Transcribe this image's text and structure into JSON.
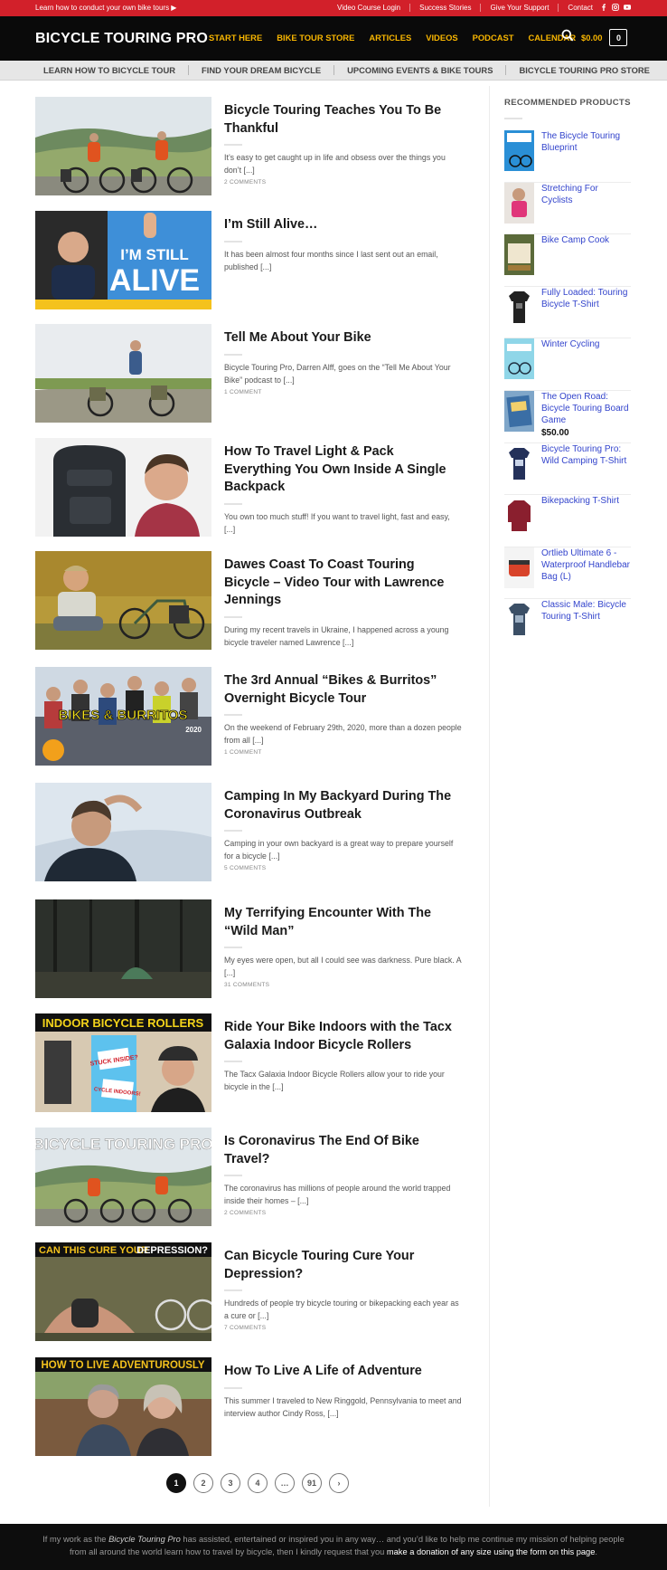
{
  "topbar": {
    "promo": "Learn how to conduct your own bike tours ▶",
    "links": [
      "Video Course Login",
      "Success Stories",
      "Give Your Support",
      "Contact"
    ]
  },
  "header": {
    "logo": "BICYCLE TOURING PRO",
    "nav": [
      "START HERE",
      "BIKE TOUR STORE",
      "ARTICLES",
      "VIDEOS",
      "PODCAST",
      "CALENDAR"
    ],
    "cart_total": "$0.00",
    "cart_count": "0"
  },
  "subnav": [
    "LEARN HOW TO BICYCLE TOUR",
    "FIND YOUR DREAM BICYCLE",
    "UPCOMING EVENTS & BIKE TOURS",
    "BICYCLE TOURING PRO STORE"
  ],
  "posts": [
    {
      "title": "Bicycle Touring Teaches You To Be Thankful",
      "excerpt": "It’s easy to get caught up in life and obsess over the things you don’t [...]",
      "comments": "2 COMMENTS"
    },
    {
      "title": "I’m Still Alive…",
      "excerpt": " It has been almost four months since I last sent out an email, published [...]",
      "comments": ""
    },
    {
      "title": "Tell Me About Your Bike",
      "excerpt": "Bicycle Touring Pro, Darren Alff, goes on the “Tell Me About Your Bike” podcast to [...]",
      "comments": "1 COMMENT"
    },
    {
      "title": "How To Travel Light & Pack Everything You Own Inside A Single Backpack",
      "excerpt": " You own too much stuff! If you want to travel light, fast and easy, [...]",
      "comments": ""
    },
    {
      "title": "Dawes Coast To Coast Touring Bicycle – Video Tour with Lawrence Jennings",
      "excerpt": "During my recent travels in Ukraine, I happened across a young bicycle traveler named Lawrence [...]",
      "comments": ""
    },
    {
      "title": "The 3rd Annual “Bikes & Burritos” Overnight Bicycle Tour",
      "excerpt": " On the weekend of February 29th, 2020, more than a dozen people from all [...]",
      "comments": "1 COMMENT"
    },
    {
      "title": "Camping In My Backyard During The Coronavirus Outbreak",
      "excerpt": "Camping in your own backyard is a great way to prepare yourself for a bicycle [...]",
      "comments": "5 COMMENTS"
    },
    {
      "title": "My Terrifying Encounter With The “Wild Man”",
      "excerpt": " My eyes were open, but all I could see was darkness. Pure black. A [...]",
      "comments": "31 COMMENTS"
    },
    {
      "title": "Ride Your Bike Indoors with the Tacx Galaxia Indoor Bicycle Rollers",
      "excerpt": " The Tacx Galaxia Indoor Bicycle Rollers allow your to ride your bicycle in the [...]",
      "comments": ""
    },
    {
      "title": "Is Coronavirus The End Of Bike Travel?",
      "excerpt": " The coronavirus has millions of people around the world trapped inside their homes – [...]",
      "comments": "2 COMMENTS"
    },
    {
      "title": "Can Bicycle Touring Cure Your Depression?",
      "excerpt": " Hundreds of people try bicycle touring or bikepacking each year as a cure or [...]",
      "comments": "7 COMMENTS"
    },
    {
      "title": "How To Live A Life of Adventure",
      "excerpt": "This summer I traveled to New Ringgold, Pennsylvania to meet and interview author Cindy Ross, [...]",
      "comments": ""
    }
  ],
  "thumb_texts": {
    "still_alive_1": "I’M STILL",
    "still_alive_2": "ALIVE",
    "bikes_burritos": "BIKES & BURRITOS",
    "bikes_burritos_year": "2020",
    "rollers_banner": "INDOOR BICYCLE ROLLERS",
    "rollers_stuck": "STUCK INSIDE?",
    "rollers_cycle": "CYCLE INDOORS!",
    "btp_banner": "BICYCLE TOURING PRO",
    "depression_banner_1": "CAN THIS CURE YOUR",
    "depression_banner_2": "DEPRESSION?",
    "adventure_banner": "HOW TO LIVE ADVENTUROUSLY"
  },
  "sidebar": {
    "title": "RECOMMENDED PRODUCTS",
    "products": [
      {
        "name": "The Bicycle Touring Blueprint",
        "price": ""
      },
      {
        "name": "Stretching For Cyclists",
        "price": ""
      },
      {
        "name": "Bike Camp Cook",
        "price": ""
      },
      {
        "name": "Fully Loaded: Touring Bicycle T-Shirt",
        "price": ""
      },
      {
        "name": "Winter Cycling",
        "price": ""
      },
      {
        "name": "The Open Road: Bicycle Touring Board Game",
        "price": "$50.00"
      },
      {
        "name": "Bicycle Touring Pro: Wild Camping T-Shirt",
        "price": ""
      },
      {
        "name": "Bikepacking T-Shirt",
        "price": ""
      },
      {
        "name": "Ortlieb Ultimate 6 - Waterproof Handlebar Bag (L)",
        "price": ""
      },
      {
        "name": "Classic Male: Bicycle Touring T-Shirt",
        "price": ""
      }
    ]
  },
  "pagination": [
    "1",
    "2",
    "3",
    "4",
    "…",
    "91",
    "›"
  ],
  "footer": {
    "text_1": "If my work as the ",
    "italic": "Bicycle Touring Pro",
    "text_2": " has assisted, entertained or inspired you in any way… and you’d like to help me continue my mission of helping people from all around the world learn how to travel by bicycle, then I kindly request that you ",
    "cta": "make a donation of any size using the form on this page",
    "text_3": "."
  },
  "colors": {
    "accent": "#d2202a",
    "nav_gold": "#f7b500",
    "link_blue": "#3344cc",
    "header_bg": "#0a0a0a"
  }
}
